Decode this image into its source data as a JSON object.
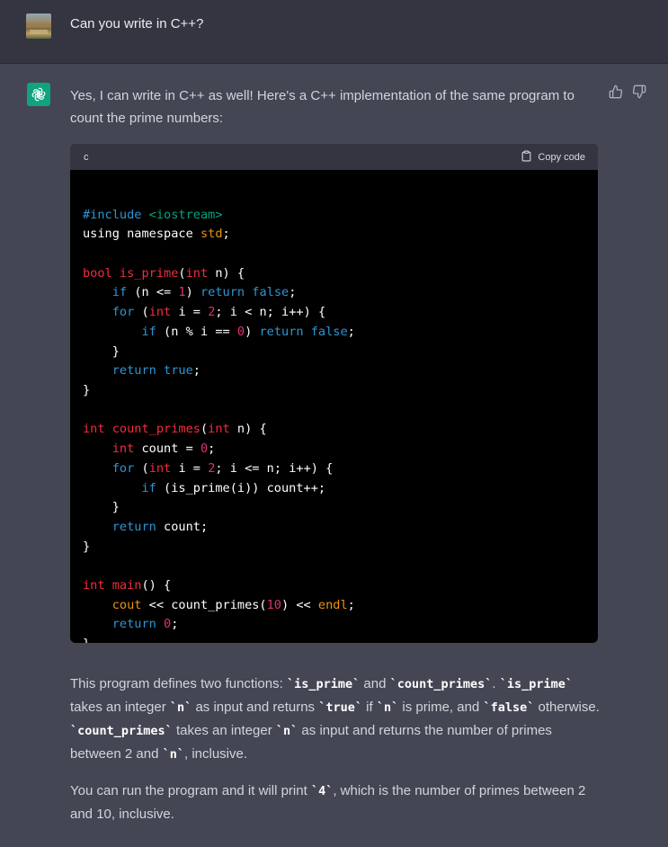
{
  "user": {
    "message": "Can you write in C++?"
  },
  "assistant": {
    "intro": "Yes, I can write in C++ as well! Here's a C++ implementation of the same program to count the prime numbers:",
    "code_block": {
      "language": "c",
      "copy_label": "Copy code",
      "lines": [
        [],
        [
          [
            "#include ",
            "k"
          ],
          [
            "<iostream>",
            "g"
          ]
        ],
        [
          [
            "using namespace ",
            ""
          ],
          [
            "std",
            "o"
          ],
          [
            ";",
            ""
          ]
        ],
        [],
        [
          [
            "bool ",
            "t"
          ],
          [
            "is_prime",
            "f"
          ],
          [
            "(",
            ""
          ],
          [
            "int ",
            "t"
          ],
          [
            "n) {",
            ""
          ]
        ],
        [
          [
            "    ",
            ""
          ],
          [
            "if ",
            "k"
          ],
          [
            "(n <= ",
            ""
          ],
          [
            "1",
            "n"
          ],
          [
            ") ",
            ""
          ],
          [
            "return false",
            "k"
          ],
          [
            ";",
            ""
          ]
        ],
        [
          [
            "    ",
            ""
          ],
          [
            "for ",
            "k"
          ],
          [
            "(",
            ""
          ],
          [
            "int ",
            "t"
          ],
          [
            "i = ",
            ""
          ],
          [
            "2",
            "n"
          ],
          [
            "; i < n; i++) {",
            ""
          ]
        ],
        [
          [
            "        ",
            ""
          ],
          [
            "if ",
            "k"
          ],
          [
            "(n % i == ",
            ""
          ],
          [
            "0",
            "n"
          ],
          [
            ") ",
            ""
          ],
          [
            "return false",
            "k"
          ],
          [
            ";",
            ""
          ]
        ],
        [
          [
            "    }",
            ""
          ]
        ],
        [
          [
            "    ",
            ""
          ],
          [
            "return true",
            "k"
          ],
          [
            ";",
            ""
          ]
        ],
        [
          [
            "}",
            ""
          ]
        ],
        [],
        [
          [
            "int ",
            "t"
          ],
          [
            "count_primes",
            "f"
          ],
          [
            "(",
            ""
          ],
          [
            "int ",
            "t"
          ],
          [
            "n) {",
            ""
          ]
        ],
        [
          [
            "    ",
            ""
          ],
          [
            "int ",
            "t"
          ],
          [
            "count = ",
            ""
          ],
          [
            "0",
            "n"
          ],
          [
            ";",
            ""
          ]
        ],
        [
          [
            "    ",
            ""
          ],
          [
            "for ",
            "k"
          ],
          [
            "(",
            ""
          ],
          [
            "int ",
            "t"
          ],
          [
            "i = ",
            ""
          ],
          [
            "2",
            "n"
          ],
          [
            "; i <= n; i++) {",
            ""
          ]
        ],
        [
          [
            "        ",
            ""
          ],
          [
            "if ",
            "k"
          ],
          [
            "(is_prime(i)) count++;",
            ""
          ]
        ],
        [
          [
            "    }",
            ""
          ]
        ],
        [
          [
            "    ",
            ""
          ],
          [
            "return ",
            "k"
          ],
          [
            "count;",
            ""
          ]
        ],
        [
          [
            "}",
            ""
          ]
        ],
        [],
        [
          [
            "int ",
            "t"
          ],
          [
            "main",
            "f"
          ],
          [
            "() {",
            ""
          ]
        ],
        [
          [
            "    ",
            ""
          ],
          [
            "cout ",
            "o"
          ],
          [
            "<< count_primes(",
            ""
          ],
          [
            "10",
            "n"
          ],
          [
            ") << ",
            ""
          ],
          [
            "endl",
            "o"
          ],
          [
            ";",
            ""
          ]
        ],
        [
          [
            "    ",
            ""
          ],
          [
            "return ",
            "k"
          ],
          [
            "0",
            "n"
          ],
          [
            ";",
            ""
          ]
        ],
        [
          [
            "}",
            ""
          ]
        ]
      ]
    },
    "para1": [
      [
        "This program defines two functions: ",
        ""
      ],
      [
        "`is_prime`",
        "b"
      ],
      [
        " and ",
        ""
      ],
      [
        "`count_primes`",
        "b"
      ],
      [
        ". ",
        ""
      ],
      [
        "`is_prime`",
        "b"
      ],
      [
        " takes an integer ",
        ""
      ],
      [
        "`n`",
        "b"
      ],
      [
        " as input and returns ",
        ""
      ],
      [
        "`true`",
        "b"
      ],
      [
        " if ",
        ""
      ],
      [
        "`n`",
        "b"
      ],
      [
        " is prime, and ",
        ""
      ],
      [
        "`false`",
        "b"
      ],
      [
        " otherwise. ",
        ""
      ],
      [
        "`count_primes`",
        "b"
      ],
      [
        " takes an integer ",
        ""
      ],
      [
        "`n`",
        "b"
      ],
      [
        " as input and returns the number of primes between 2 and ",
        ""
      ],
      [
        "`n`",
        "b"
      ],
      [
        ", inclusive.",
        ""
      ]
    ],
    "para2": [
      [
        "You can run the program and it will print ",
        ""
      ],
      [
        "`4`",
        "b"
      ],
      [
        ", which is the number of primes between 2 and 10, inclusive.",
        ""
      ]
    ]
  },
  "colors": {
    "background": "#444654",
    "user_row": "#343541",
    "accent": "#10a37f",
    "code_bg": "#000000"
  },
  "icons": [
    "user-avatar",
    "openai-logo-icon",
    "thumbs-up-icon",
    "thumbs-down-icon",
    "clipboard-icon"
  ]
}
